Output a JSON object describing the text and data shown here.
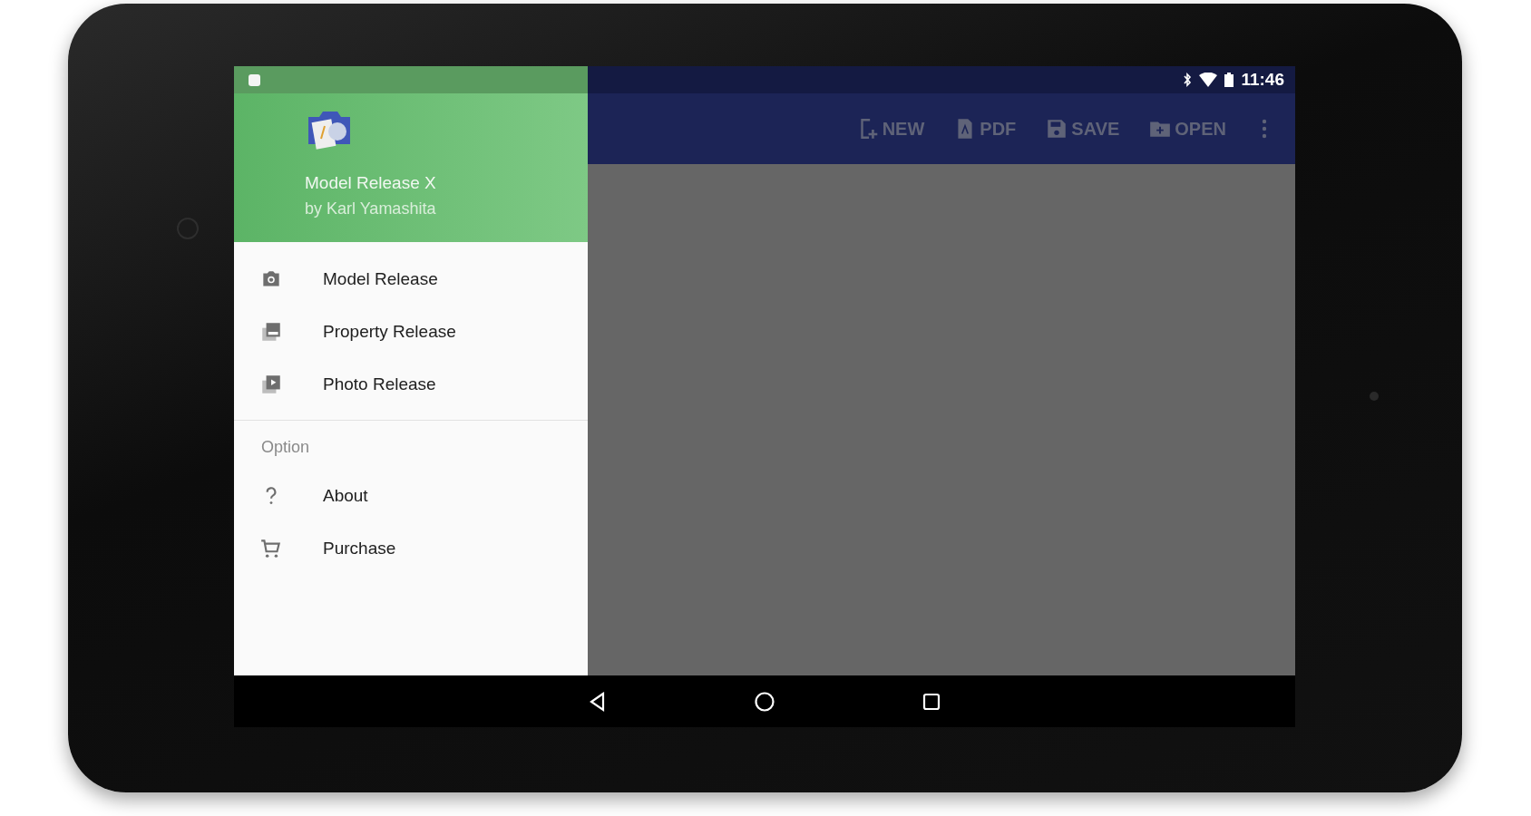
{
  "status_bar": {
    "time": "11:46"
  },
  "drawer": {
    "header": {
      "title": "Model Release X",
      "subtitle": "by Karl Yamashita"
    },
    "items": [
      {
        "label": "Model Release",
        "kind": "camera"
      },
      {
        "label": "Property Release",
        "kind": "stack"
      },
      {
        "label": "Photo Release",
        "kind": "play"
      }
    ],
    "option_section": {
      "title": "Option",
      "items": [
        {
          "label": "About",
          "kind": "help"
        },
        {
          "label": "Purchase",
          "kind": "cart"
        }
      ]
    }
  },
  "toolbar": {
    "actions": [
      {
        "label": "NEW",
        "kind": "new"
      },
      {
        "label": "PDF",
        "kind": "pdf"
      },
      {
        "label": "SAVE",
        "kind": "save"
      },
      {
        "label": "OPEN",
        "kind": "open"
      }
    ]
  }
}
